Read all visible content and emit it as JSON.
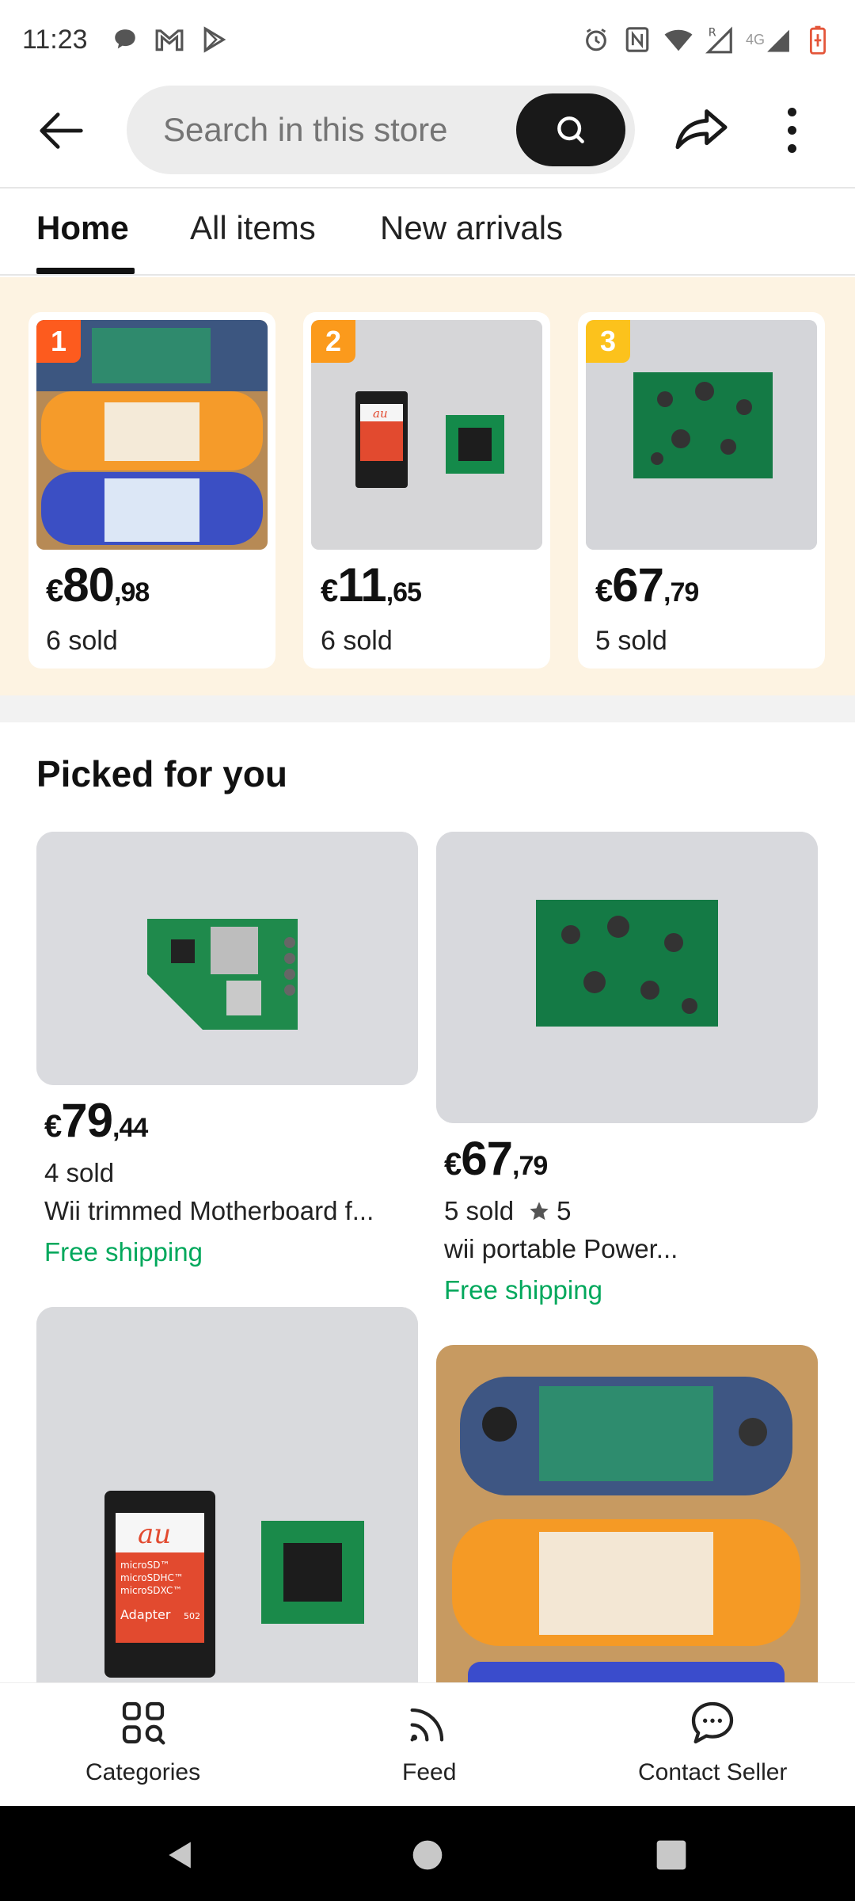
{
  "status_bar": {
    "time": "11:23",
    "network": "4G"
  },
  "header": {
    "search_placeholder": "Search in this store"
  },
  "tabs": [
    {
      "label": "Home",
      "active": true
    },
    {
      "label": "All items",
      "active": false
    },
    {
      "label": "New arrivals",
      "active": false
    }
  ],
  "top_items": [
    {
      "rank": "1",
      "currency": "€",
      "price_whole": "80",
      "price_cents": ",98",
      "sold": "6 sold"
    },
    {
      "rank": "2",
      "currency": "€",
      "price_whole": "11",
      "price_cents": ",65",
      "sold": "6 sold"
    },
    {
      "rank": "3",
      "currency": "€",
      "price_whole": "67",
      "price_cents": ",79",
      "sold": "5 sold"
    }
  ],
  "picked": {
    "title": "Picked for you",
    "items": [
      {
        "currency": "€",
        "price_whole": "79",
        "price_cents": ",44",
        "sold": "4 sold",
        "rating": "",
        "title": "Wii  trimmed   Motherboard f...",
        "shipping": "Free shipping"
      },
      {
        "currency": "€",
        "price_whole": "67",
        "price_cents": ",79",
        "sold": "5 sold",
        "rating": "5",
        "title": "wii portable   Power...",
        "shipping": "Free shipping"
      }
    ]
  },
  "sd_adapter_label": {
    "brand": "au",
    "lines": [
      "microSD™",
      "microSDHC™",
      "microSDXC™"
    ],
    "adapter": "Adapter",
    "model": "502"
  },
  "bottom_nav": [
    {
      "label": "Categories",
      "icon": "categories-icon"
    },
    {
      "label": "Feed",
      "icon": "feed-icon"
    },
    {
      "label": "Contact Seller",
      "icon": "chat-icon"
    }
  ],
  "colors": {
    "accent_green": "#02a85c",
    "rank1": "#fd5b1e",
    "rank2": "#fb9a1c",
    "rank3": "#fcc21c",
    "band": "#fdf3e2"
  }
}
